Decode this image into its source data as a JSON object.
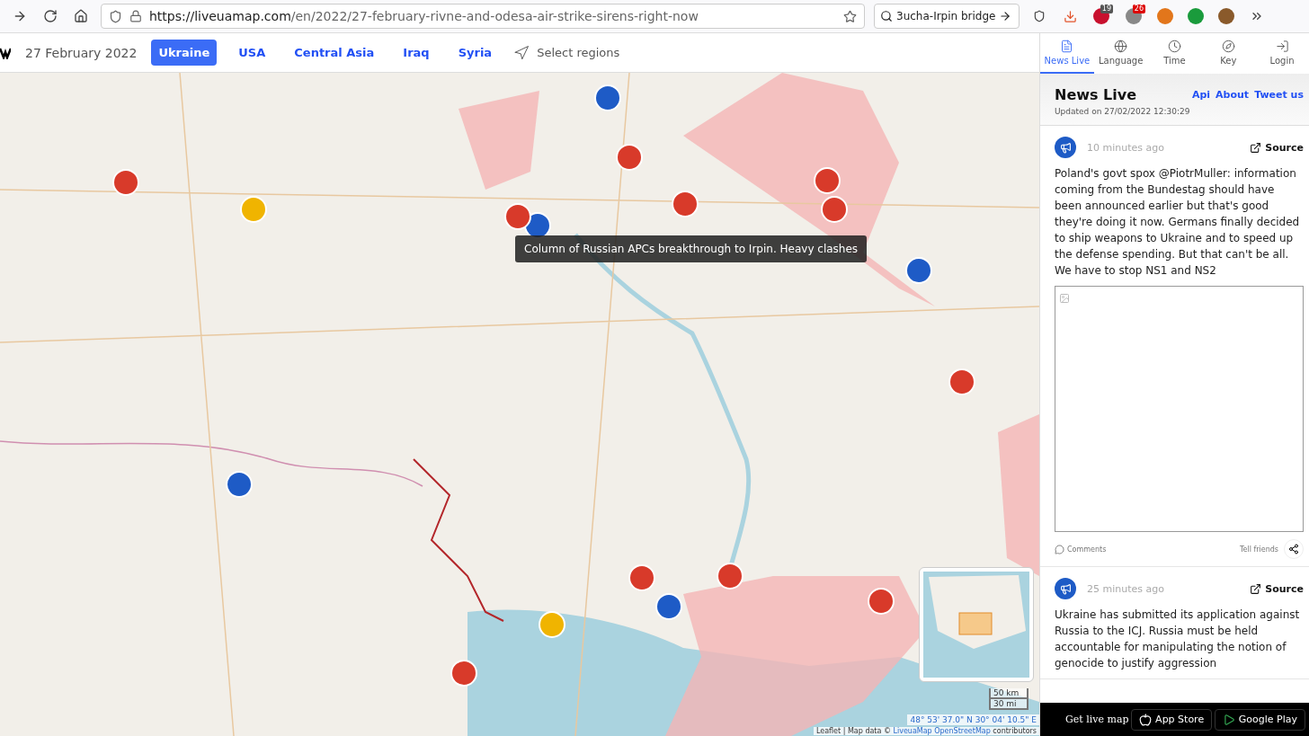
{
  "browser": {
    "url_host": "https://liveuamap.com",
    "url_path": "/en/2022/27-february-rivne-and-odesa-air-strike-sirens-right-now",
    "search": "3ucha-Irpin bridge",
    "badges": [
      "19",
      "26"
    ]
  },
  "nav": {
    "date": "27 February 2022",
    "regions": [
      {
        "label": "Ukraine",
        "selected": true
      },
      {
        "label": "USA",
        "selected": false
      },
      {
        "label": "Central Asia",
        "selected": false
      },
      {
        "label": "Iraq",
        "selected": false
      },
      {
        "label": "Syria",
        "selected": false
      }
    ],
    "select_regions": "Select regions"
  },
  "map": {
    "tooltip": "Column of Russian APCs breakthrough to Irpin. Heavy clashes",
    "scale": [
      "50 km",
      "30 mi"
    ],
    "coordinates": "48° 53' 37.0\" N 30° 04' 10.5\" E",
    "attribution_prefix": "Leaflet | Map data © ",
    "attribution_link": "LiveuaMap OpenStreetMap",
    "attribution_suffix": " contributors"
  },
  "panel": {
    "tabs": [
      {
        "label": "News Live",
        "kind": "news",
        "selected": true
      },
      {
        "label": "Language",
        "kind": "language",
        "selected": false
      },
      {
        "label": "Time",
        "kind": "time",
        "selected": false
      },
      {
        "label": "Key",
        "kind": "key",
        "selected": false
      },
      {
        "label": "Login",
        "kind": "login",
        "selected": false
      }
    ],
    "title": "News Live",
    "links": [
      "Api",
      "About",
      "Tweet us"
    ],
    "updated": "Updated on 27/02/2022 12:30:29",
    "news": [
      {
        "time": "10 minutes ago",
        "source": "Source",
        "text": "Poland's govt spox @PiotrMuller: information coming from the Bundestag should have been announced earlier but that's good they're doing it now. Germans finally decided to ship weapons to Ukraine and to speed up the defense spending. But that can't be all. We have to stop NS1 and NS2",
        "has_image": true,
        "comments": "Comments",
        "share": "Tell friends"
      },
      {
        "time": "25 minutes ago",
        "source": "Source",
        "text": "Ukraine has submitted its application against Russia to the ICJ. Russia must be held accountable for manipulating the notion of genocide to justify aggression",
        "has_image": false
      }
    ],
    "footer": {
      "label": "Get live map",
      "stores": [
        {
          "label": "App Store",
          "kind": "apple"
        },
        {
          "label": "Google Play",
          "kind": "google"
        }
      ]
    }
  }
}
